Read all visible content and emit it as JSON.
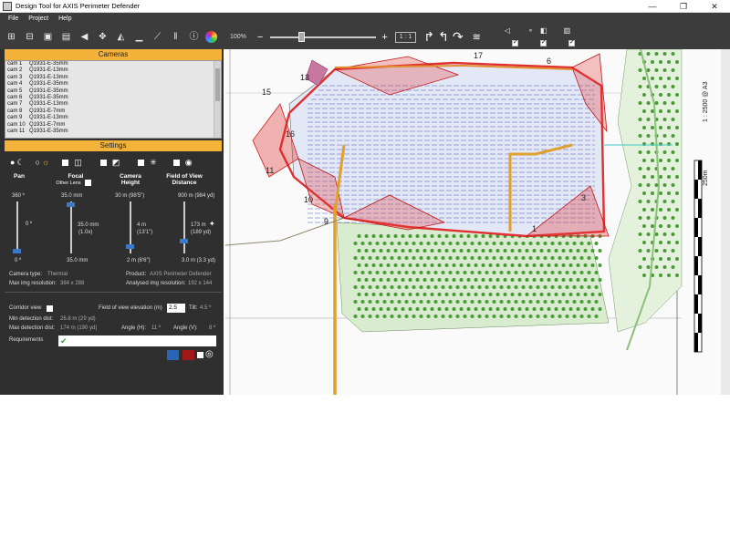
{
  "window": {
    "title": "Design Tool for AXIS Perimeter Defender",
    "minimize": "—",
    "restore": "❐",
    "close": "✕"
  },
  "menu": [
    "File",
    "Project",
    "Help"
  ],
  "toolbar": {
    "zoom_label": "100%",
    "zoom_fraction": 0.28,
    "ratio_label": "1 : 1"
  },
  "cameras": {
    "header": "Cameras",
    "items": [
      {
        "name": "cam 1",
        "model": "Q1931-E-35mm"
      },
      {
        "name": "cam 2",
        "model": "Q1931-E-13mm"
      },
      {
        "name": "cam 3",
        "model": "Q1931-E-13mm"
      },
      {
        "name": "cam 4",
        "model": "Q1931-E-35mm"
      },
      {
        "name": "cam 5",
        "model": "Q1931-E-35mm"
      },
      {
        "name": "cam 6",
        "model": "Q1931-E-35mm"
      },
      {
        "name": "cam 7",
        "model": "Q1931-E-13mm"
      },
      {
        "name": "cam 8",
        "model": "Q1931-E-7mm"
      },
      {
        "name": "cam 9",
        "model": "Q1931-E-13mm"
      },
      {
        "name": "cam 10",
        "model": "Q1931-E-7mm"
      },
      {
        "name": "cam 11",
        "model": "Q1931-E-35mm"
      }
    ]
  },
  "settings": {
    "header": "Settings",
    "columns": {
      "pan": "Pan",
      "focal": "Focal",
      "other_lens": "Other Lens",
      "camera_height_1": "Camera",
      "camera_height_2": "Height",
      "fov_1": "Field of View",
      "fov_2": "Distance"
    },
    "pan": {
      "top": "360 º",
      "mid": "0 º",
      "bottom": "0 º"
    },
    "focal": {
      "top": "35.0 mm",
      "mid_1": "35.0 mm",
      "mid_2": "(1.0x)",
      "bottom": "35.0 mm"
    },
    "height": {
      "top": "30 m (98'5\")",
      "mid_1": "4 m",
      "mid_2": "(13'1\")",
      "bottom": "2 m (6'6\")"
    },
    "fov": {
      "top": "900 m (984 yd)",
      "mid_1": "173 m",
      "mid_2": "(189 yd)",
      "bottom": "3.0 m (3.3 yd)"
    },
    "camera_type_label": "Camera type:",
    "camera_type_value": "Thermal",
    "product_label": "Product:",
    "product_value": "AXIS Perimeter Defender",
    "max_res_label": "Max img resolution:",
    "max_res_value": "384 x 288",
    "analysed_res_label": "Analysed img resolution:",
    "analysed_res_value": "192 x 144",
    "corridor_label": "Corridor view",
    "elevation_label": "Field of view elevation (m)",
    "elevation_value": "2.5",
    "tilt_label": "Tilt:",
    "tilt_value": "4.5 º",
    "min_det_label": "Min detection dist:",
    "min_det_value": "26.8 m (29 yd)",
    "max_det_label": "Max detection dist:",
    "max_det_value": "174 m (190 yd)",
    "angle_h_label": "Angle (H):",
    "angle_h_value": "11 º",
    "angle_v_label": "Angle (V):",
    "angle_v_value": "8 º",
    "requirements_label": "Requirements",
    "colors": {
      "blue": "#2a64b4",
      "red": "#a01818"
    }
  },
  "map": {
    "scale_text": "1 : 2500 @ A3",
    "scale_bar_label": "250m",
    "zone_numbers": [
      "13",
      "15",
      "16",
      "17",
      "6",
      "11",
      "10",
      "9",
      "3",
      "1"
    ]
  }
}
